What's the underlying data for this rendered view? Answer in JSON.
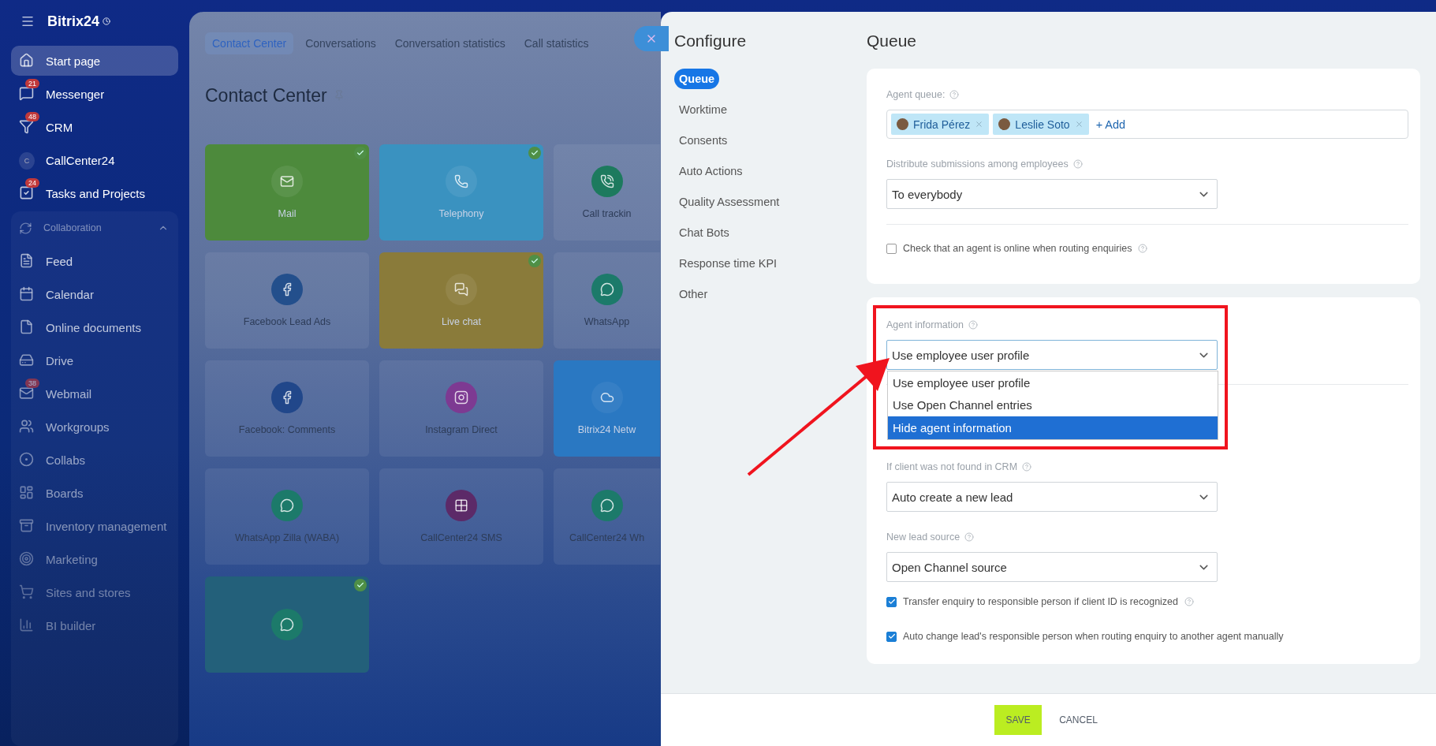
{
  "sidebar": {
    "logo": "Bitrix24",
    "items": [
      {
        "label": "Start page",
        "kind": "home",
        "selected": true
      },
      {
        "label": "Messenger",
        "kind": "messenger",
        "badge": "21",
        "selected": false
      },
      {
        "label": "CRM",
        "kind": "crm",
        "badge": "48",
        "selected": false
      },
      {
        "label": "CallCenter24",
        "kind": "avatar",
        "avatar": "C",
        "selected": false
      },
      {
        "label": "Tasks and Projects",
        "kind": "tasks",
        "badge": "24",
        "selected": false
      }
    ],
    "group": {
      "label": "Collaboration",
      "expanded": true,
      "items": [
        {
          "label": "Feed",
          "kind": "feed",
          "selected": false
        },
        {
          "label": "Calendar",
          "kind": "calendar",
          "selected": false
        },
        {
          "label": "Online documents",
          "kind": "docs",
          "selected": false
        },
        {
          "label": "Drive",
          "kind": "drive",
          "selected": false
        },
        {
          "label": "Webmail",
          "kind": "mail",
          "badge": "38",
          "selected": false
        },
        {
          "label": "Workgroups",
          "kind": "groups",
          "selected": false
        },
        {
          "label": "Collabs",
          "kind": "collabs",
          "selected": false
        },
        {
          "label": "Boards",
          "kind": "boards",
          "selected": false
        },
        {
          "label": "Inventory management",
          "kind": "inventory",
          "selected": false
        },
        {
          "label": "Marketing",
          "kind": "marketing",
          "selected": false
        },
        {
          "label": "Sites and stores",
          "kind": "sites",
          "selected": false
        },
        {
          "label": "BI builder",
          "kind": "bi",
          "selected": false
        }
      ]
    }
  },
  "contact_center": {
    "tabs": [
      {
        "label": "Contact Center",
        "selected": true
      },
      {
        "label": "Conversations",
        "selected": false
      },
      {
        "label": "Conversation statistics",
        "selected": false
      },
      {
        "label": "Call statistics",
        "selected": false
      }
    ],
    "title": "Contact Center",
    "tiles": [
      {
        "label": "Mail",
        "kind": "mail",
        "color": "#4d8a3c",
        "checked": true
      },
      {
        "label": "Telephony",
        "kind": "phone",
        "color": "#3a92c0",
        "checked": true
      },
      {
        "label": "Call trackin",
        "kind": "tracking",
        "checked": false
      },
      {
        "label": "Facebook Lead Ads",
        "kind": "fbleads",
        "checked": false
      },
      {
        "label": "Live chat",
        "kind": "chat",
        "color": "#8a7b3a",
        "checked": true
      },
      {
        "label": "WhatsApp",
        "kind": "whatsapp",
        "checked": false
      },
      {
        "label": "Facebook: Comments",
        "kind": "fbcomments",
        "checked": false
      },
      {
        "label": "Instagram Direct",
        "kind": "instagram",
        "checked": false
      },
      {
        "label": "Bitrix24 Netw",
        "kind": "cloud",
        "color": "#2a78c2",
        "checked": false
      },
      {
        "label": "WhatsApp Zilla (WABA)",
        "kind": "whatsapp",
        "checked": false
      },
      {
        "label": "CallCenter24 SMS",
        "kind": "sms",
        "checked": false
      },
      {
        "label": "CallCenter24 Wh",
        "kind": "whatsapp",
        "checked": false
      },
      {
        "kind": "whatsapp",
        "color": "#23607a",
        "checked": true
      }
    ]
  },
  "config": {
    "title": "Configure",
    "nav": [
      {
        "label": "Queue",
        "selected": true
      },
      {
        "label": "Worktime",
        "selected": false
      },
      {
        "label": "Consents",
        "selected": false
      },
      {
        "label": "Auto Actions",
        "selected": false
      },
      {
        "label": "Quality Assessment",
        "selected": false
      },
      {
        "label": "Chat Bots",
        "selected": false
      },
      {
        "label": "Response time KPI",
        "selected": false
      },
      {
        "label": "Other",
        "selected": false
      }
    ],
    "section_title": "Queue",
    "agent_queue": {
      "label": "Agent queue:",
      "agents": [
        {
          "name": "Frida Pérez"
        },
        {
          "name": "Leslie Soto"
        }
      ],
      "add": "+ Add"
    },
    "distribute": {
      "label": "Distribute submissions among employees",
      "value": "To everybody"
    },
    "online_check": {
      "label": "Check that an agent is online when routing enquiries",
      "checked": false
    },
    "agent_info": {
      "label": "Agent information",
      "value": "Use employee user profile",
      "expanded": true,
      "options": [
        {
          "label": "Use employee user profile",
          "highlighted": false
        },
        {
          "label": "Use Open Channel entries",
          "highlighted": false
        },
        {
          "label": "Hide agent information",
          "highlighted": true
        }
      ]
    },
    "crm_fallback": {
      "label": "If client was not found in CRM",
      "value": "Auto create a new lead"
    },
    "lead_source": {
      "label": "New lead source",
      "value": "Open Channel source"
    },
    "checks": [
      {
        "label": "Transfer enquiry to responsible person if client ID is recognized",
        "checked": true,
        "help": true
      },
      {
        "label": "Auto change lead's responsible person when routing enquiry to another agent manually",
        "checked": true,
        "help": false
      }
    ],
    "save": "SAVE",
    "cancel": "CANCEL"
  }
}
